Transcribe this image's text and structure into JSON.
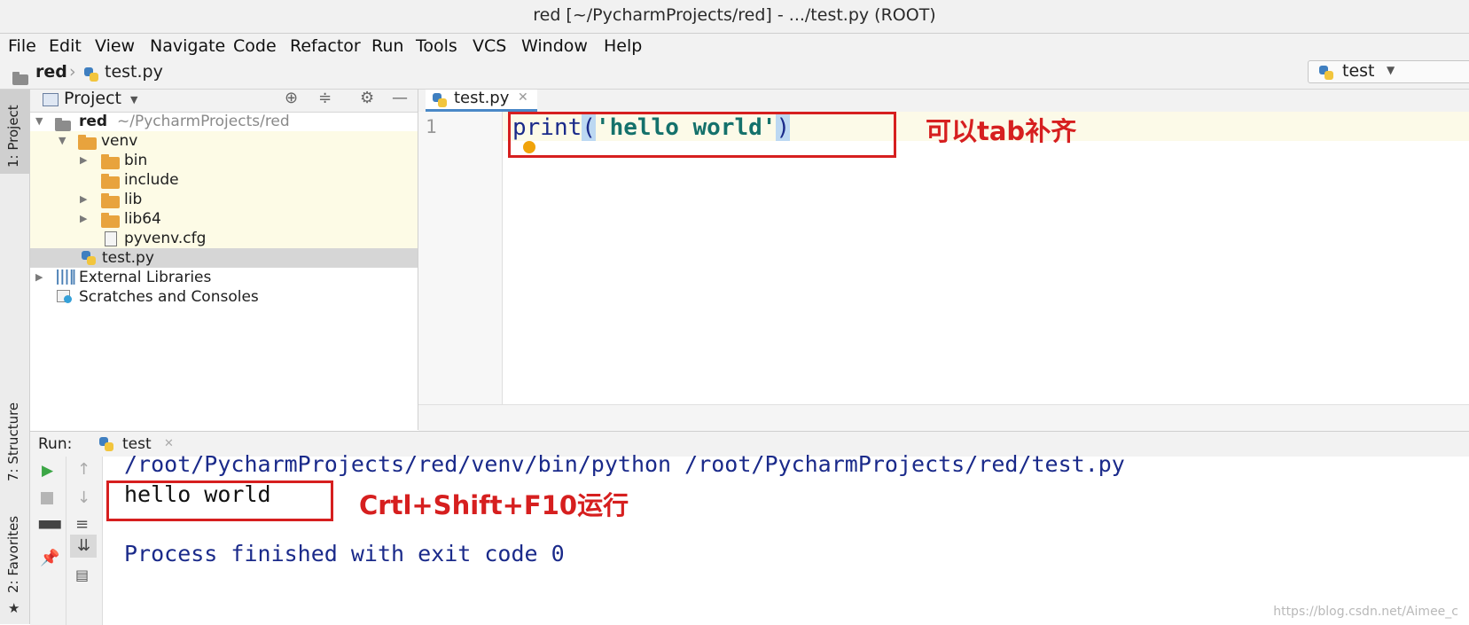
{
  "window": {
    "title": "red [~/PycharmProjects/red] - .../test.py (ROOT)"
  },
  "menu": [
    "File",
    "Edit",
    "View",
    "Navigate",
    "Code",
    "Refactor",
    "Run",
    "Tools",
    "VCS",
    "Window",
    "Help"
  ],
  "breadcrumb": {
    "project": "red",
    "file": "test.py"
  },
  "run_config": {
    "name": "test"
  },
  "sidebar_tabs": {
    "project": "1: Project",
    "structure": "7: Structure",
    "favorites": "2: Favorites"
  },
  "project_panel": {
    "title": "Project",
    "tree": {
      "root_name": "red",
      "root_path": "~/PycharmProjects/red",
      "venv": "venv",
      "bin": "bin",
      "include": "include",
      "lib": "lib",
      "lib64": "lib64",
      "cfg": "pyvenv.cfg",
      "file": "test.py",
      "external": "External Libraries",
      "scratches": "Scratches and Consoles"
    }
  },
  "editor": {
    "tab": "test.py",
    "line_number": "1",
    "code": {
      "func": "print",
      "open": "(",
      "str": "'hello world'",
      "close": ")"
    }
  },
  "run": {
    "label": "Run:",
    "tab": "test",
    "command": "/root/PycharmProjects/red/venv/bin/python /root/PycharmProjects/red/test.py",
    "output": "hello world",
    "exit": "Process finished with exit code 0"
  },
  "annotations": {
    "editor_note": "可以tab补齐",
    "run_note": "Crtl+Shift+F10运行"
  },
  "watermark": "https://blog.csdn.net/Aimee_c",
  "colors": {
    "annotation": "#d61f1f",
    "console_text": "#1a2a8a",
    "string": "#14716b",
    "folder": "#e8a33d"
  }
}
